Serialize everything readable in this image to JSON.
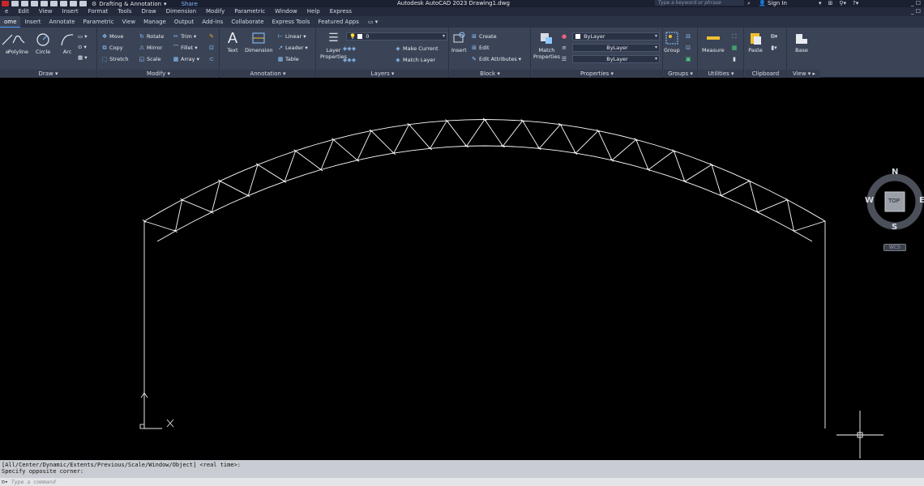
{
  "titlebar": {
    "workspace": "Drafting & Annotation",
    "share": "Share",
    "app_title": "Autodesk AutoCAD 2023   Drawing1.dwg",
    "search_placeholder": "Type a keyword or phrase",
    "sign_in": "Sign In",
    "window_controls": "_ ☐"
  },
  "menubar": {
    "items": [
      "e",
      "Edit",
      "View",
      "Insert",
      "Format",
      "Tools",
      "Draw",
      "Dimension",
      "Modify",
      "Parametric",
      "Window",
      "Help",
      "Express"
    ],
    "right": "_ ☐"
  },
  "ribbon_tabs": {
    "items": [
      "ome",
      "Insert",
      "Annotate",
      "Parametric",
      "View",
      "Manage",
      "Output",
      "Add-ins",
      "Collaborate",
      "Express Tools",
      "Featured Apps"
    ],
    "active_index": 0,
    "extra": "▭ ▾"
  },
  "ribbon": {
    "draw": {
      "footer": "Draw ▾",
      "line": "e",
      "polyline": "Polyline",
      "circle": "Circle",
      "arc": "Arc"
    },
    "modify": {
      "footer": "Modify ▾",
      "move": "Move",
      "rotate": "Rotate",
      "trim": "Trim ▾",
      "copy": "Copy",
      "mirror": "Mirror",
      "fillet": "Fillet ▾",
      "stretch": "Stretch",
      "scale": "Scale",
      "array": "Array ▾"
    },
    "annotation": {
      "footer": "Annotation ▾",
      "text": "Text",
      "dimension": "Dimension",
      "linear": "Linear ▾",
      "leader": "Leader ▾",
      "table": "Table"
    },
    "layers": {
      "footer": "Layers ▾",
      "layer_properties_1": "Layer",
      "layer_properties_2": "Properties",
      "current_layer": "0",
      "make_current": "Make Current",
      "match_layer": "Match Layer"
    },
    "block": {
      "footer": "Block ▾",
      "insert": "Insert",
      "create": "Create",
      "edit": "Edit",
      "edit_attributes": "Edit Attributes ▾"
    },
    "properties": {
      "footer": "Properties ▾",
      "match_1": "Match",
      "match_2": "Properties",
      "color": "ByLayer",
      "lineweight": "ByLayer",
      "linetype": "ByLayer"
    },
    "groups": {
      "footer": "Groups ▾",
      "group": "Group"
    },
    "utilities": {
      "footer": "Utilities ▾",
      "measure": "Measure"
    },
    "clipboard": {
      "footer": "Clipboard",
      "paste": "Paste"
    },
    "view": {
      "footer": "View ▾ ▸",
      "base": "Base"
    }
  },
  "viewcube": {
    "north": "N",
    "south": "S",
    "east": "E",
    "west": "W",
    "face": "TOP",
    "wcs": "WCS"
  },
  "command": {
    "history_line_1": "[All/Center/Dynamic/Extents/Previous/Scale/Window/Object] <real time>:",
    "history_line_2": "Specify opposite corner:",
    "placeholder": "Type a command",
    "icon": "⊡▾"
  },
  "colors": {
    "background": "#000000",
    "ribbon": "#3b4457",
    "title": "#1a2030",
    "accent": "#4c9cff",
    "drawing_line": "#ffffff"
  }
}
